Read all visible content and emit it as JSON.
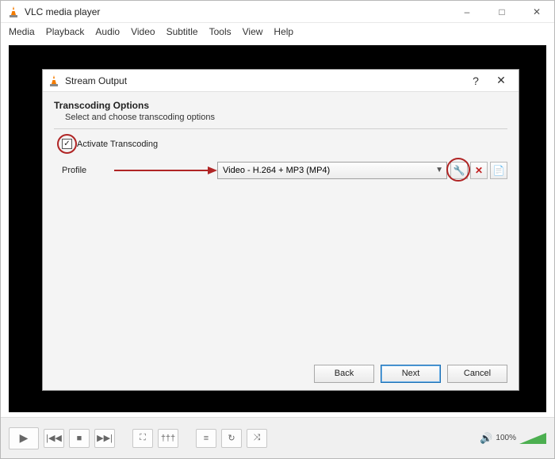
{
  "app": {
    "title": "VLC media player"
  },
  "menubar": [
    "Media",
    "Playback",
    "Audio",
    "Video",
    "Subtitle",
    "Tools",
    "View",
    "Help"
  ],
  "volume": {
    "percent": "100%"
  },
  "dialog": {
    "title": "Stream Output",
    "section_title": "Transcoding Options",
    "section_subtitle": "Select and choose transcoding options",
    "activate_label": "Activate Transcoding",
    "activate_checked": true,
    "profile_label": "Profile",
    "profile_value": "Video - H.264 + MP3 (MP4)",
    "buttons": {
      "back": "Back",
      "next": "Next",
      "cancel": "Cancel"
    },
    "help_symbol": "?",
    "close_symbol": "✕"
  },
  "annotations": {
    "checkbox_circled": true,
    "arrow_to_profile": true,
    "tools_button_circled": true
  }
}
